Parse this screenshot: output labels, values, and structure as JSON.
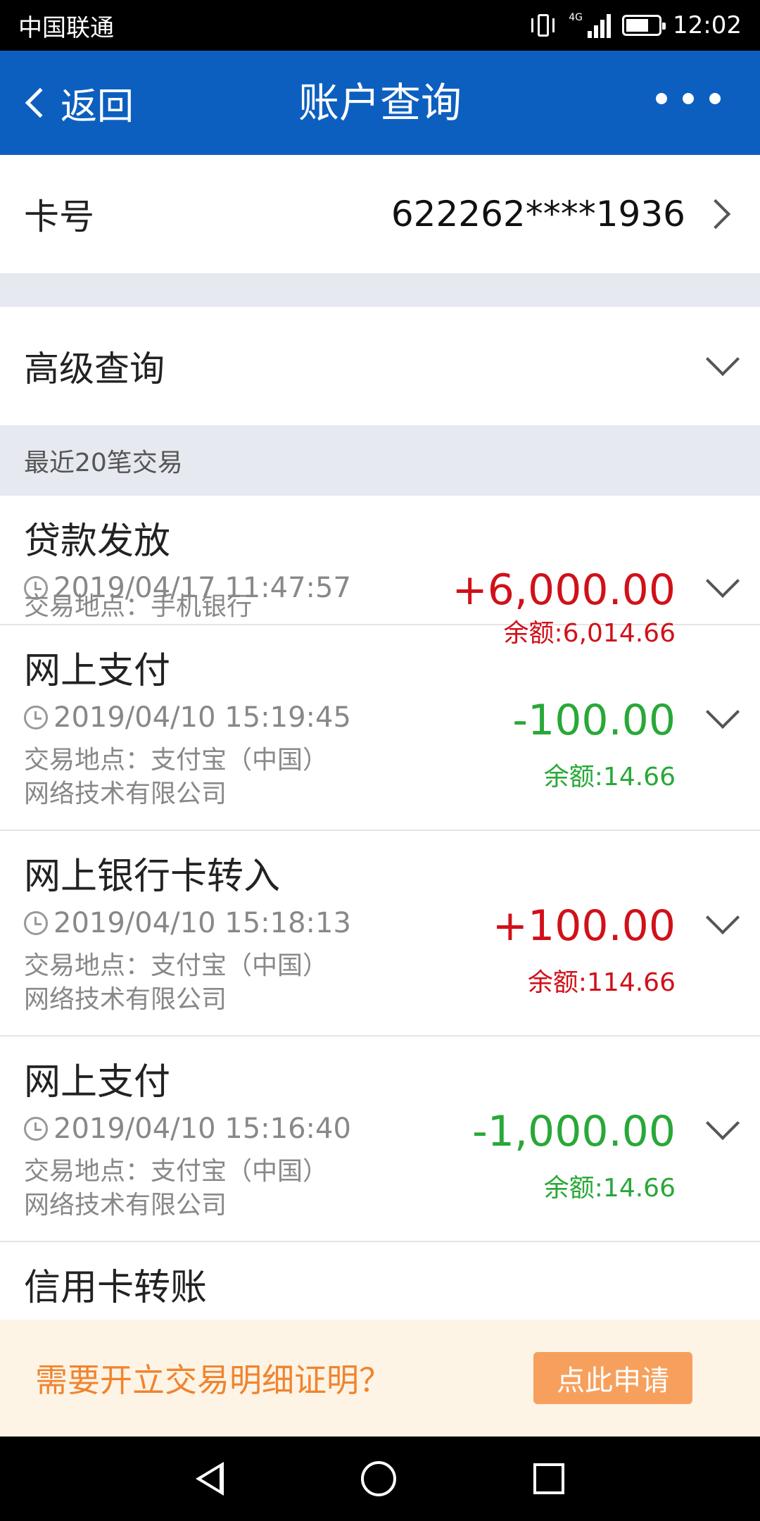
{
  "status_bar": {
    "carrier": "中国联通",
    "network": "4G",
    "time": "12:02",
    "battery_level": 0.7
  },
  "nav": {
    "back_label": "返回",
    "title": "账户查询"
  },
  "card": {
    "label": "卡号",
    "number": "622262****1936"
  },
  "advanced": {
    "label": "高级查询"
  },
  "recent": {
    "header": "最近20笔交易",
    "transactions": [
      {
        "title": "贷款发放",
        "time": "2019/04/17 11:47:57",
        "place": "交易地点：手机银行",
        "amount": "+6,000.00",
        "balance": "余额:6,014.66",
        "direction": "in"
      },
      {
        "title": "网上支付",
        "time": "2019/04/10 15:19:45",
        "place": "交易地点：支付宝（中国）网络技术有限公司",
        "amount": "-100.00",
        "balance": "余额:14.66",
        "direction": "out"
      },
      {
        "title": "网上银行卡转入",
        "time": "2019/04/10 15:18:13",
        "place": "交易地点：支付宝（中国）网络技术有限公司",
        "amount": "+100.00",
        "balance": "余额:114.66",
        "direction": "in"
      },
      {
        "title": "网上支付",
        "time": "2019/04/10 15:16:40",
        "place": "交易地点：支付宝（中国）网络技术有限公司",
        "amount": "-1,000.00",
        "balance": "余额:14.66",
        "direction": "out"
      },
      {
        "title": "信用卡转账",
        "time": "",
        "place": "",
        "amount": "",
        "balance": "",
        "direction": "in"
      }
    ]
  },
  "banner": {
    "message": "需要开立交易明细证明？",
    "button": "点此申请"
  },
  "colors": {
    "nav_blue": "#0d5fbf",
    "credit_red": "#d0111a",
    "debit_green": "#29a838",
    "banner_bg": "#fdf4e5",
    "banner_text": "#f0842f",
    "banner_button": "#f7a05e"
  }
}
